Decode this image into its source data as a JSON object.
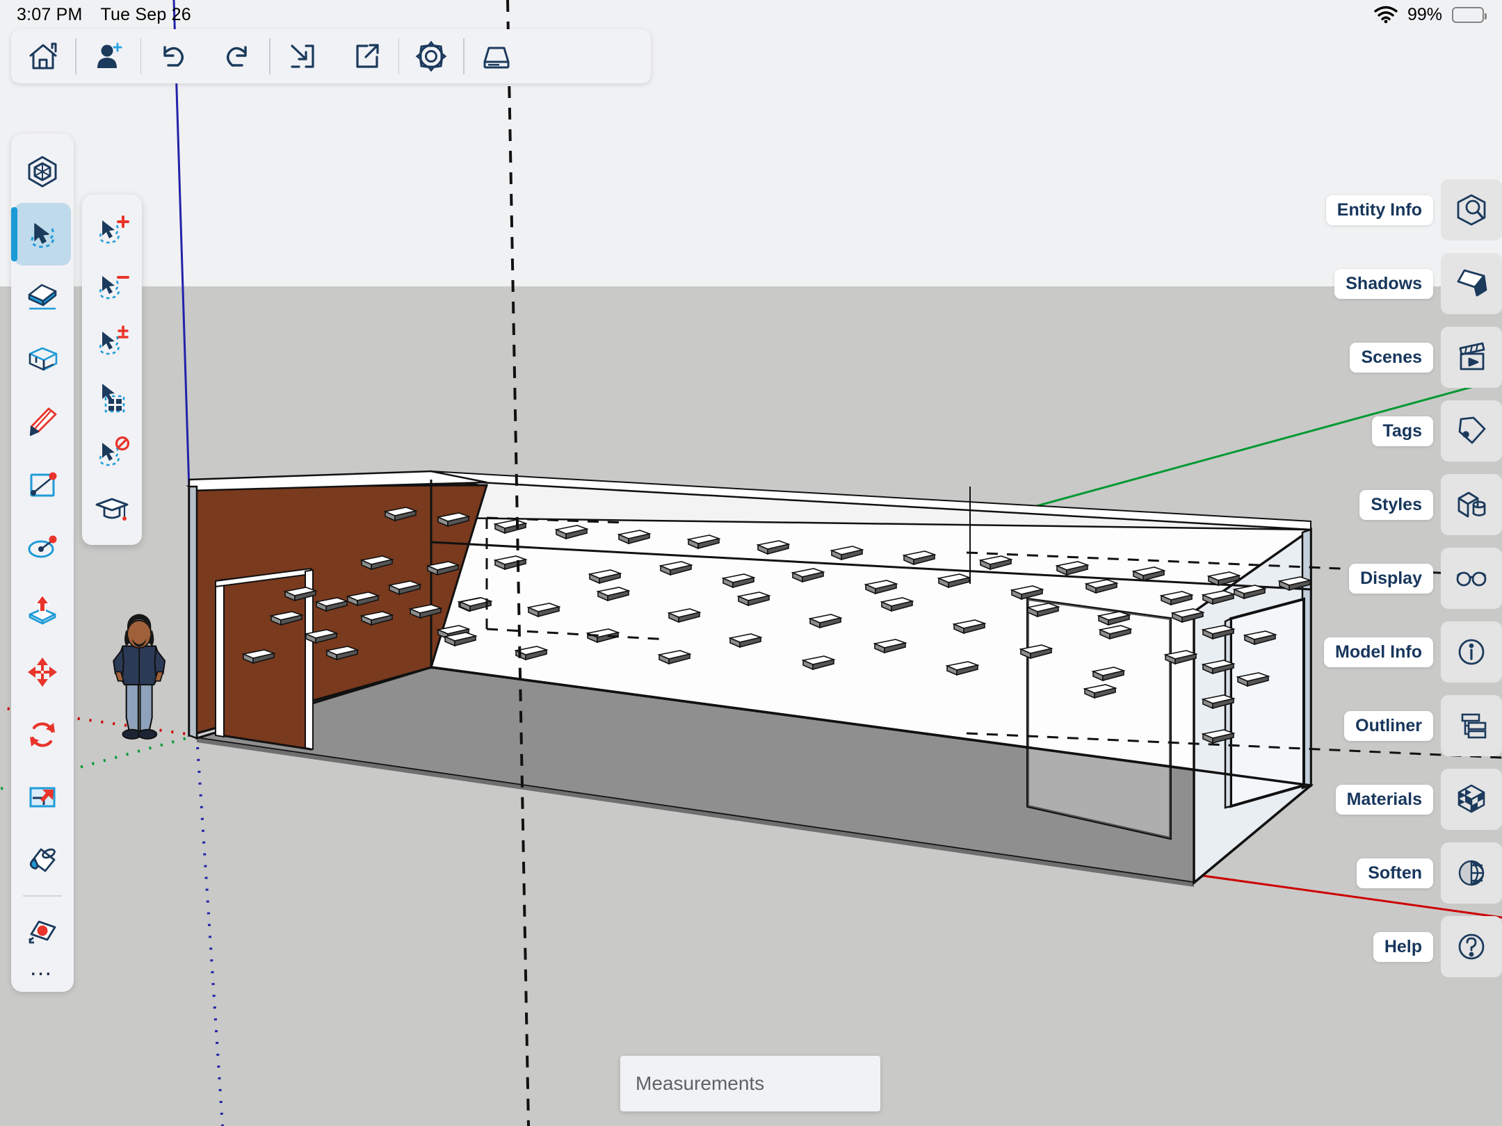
{
  "status_bar": {
    "time": "3:07 PM",
    "date": "Tue Sep 26",
    "battery_percent": "99%",
    "wifi_icon": "wifi-icon",
    "battery_icon": "battery-full-icon"
  },
  "top_toolbar": {
    "buttons": [
      {
        "name": "home-button",
        "icon": "home-icon",
        "label": "Home"
      },
      {
        "name": "add-user-button",
        "icon": "person-plus-icon",
        "label": "Invite"
      },
      {
        "name": "undo-button",
        "icon": "undo-icon",
        "label": "Undo"
      },
      {
        "name": "redo-button",
        "icon": "redo-icon",
        "label": "Redo"
      },
      {
        "name": "import-button",
        "icon": "import-icon",
        "label": "Import"
      },
      {
        "name": "export-button",
        "icon": "export-icon",
        "label": "Export"
      },
      {
        "name": "settings-button",
        "icon": "gear-icon",
        "label": "Settings"
      },
      {
        "name": "save-button",
        "icon": "disk-icon",
        "label": "Save"
      }
    ]
  },
  "left_toolbar": {
    "tools": [
      {
        "name": "tool-model",
        "icon": "cube-outline-icon",
        "label": "Model",
        "active": false
      },
      {
        "name": "tool-select",
        "icon": "select-lasso-icon",
        "label": "Select",
        "active": true
      },
      {
        "name": "tool-eraser",
        "icon": "eraser-icon",
        "label": "Eraser",
        "active": false
      },
      {
        "name": "tool-rectangle",
        "icon": "box-icon",
        "label": "Rectangle",
        "active": false
      },
      {
        "name": "tool-pencil",
        "icon": "pencil-icon",
        "label": "Line",
        "active": false
      },
      {
        "name": "tool-shape",
        "icon": "square-diagonal-icon",
        "label": "Shapes",
        "active": false
      },
      {
        "name": "tool-arc",
        "icon": "arc-icon",
        "label": "Arc",
        "active": false
      },
      {
        "name": "tool-pushpull",
        "icon": "push-pull-icon",
        "label": "Push/Pull",
        "active": false
      },
      {
        "name": "tool-move",
        "icon": "move-icon",
        "label": "Move",
        "active": false
      },
      {
        "name": "tool-rotate",
        "icon": "rotate-icon",
        "label": "Rotate",
        "active": false
      },
      {
        "name": "tool-scale",
        "icon": "scale-icon",
        "label": "Scale",
        "active": false
      },
      {
        "name": "tool-paint",
        "icon": "paint-bucket-icon",
        "label": "Paint",
        "active": false
      },
      {
        "name": "tool-tape",
        "icon": "tape-measure-icon",
        "label": "Tape Measure",
        "active": false
      }
    ],
    "more_label": "…"
  },
  "select_flyout": {
    "items": [
      {
        "name": "select-add-option",
        "icon": "cursor-plus-icon",
        "label": "Add to Selection"
      },
      {
        "name": "select-subtract-option",
        "icon": "cursor-minus-icon",
        "label": "Subtract from Selection"
      },
      {
        "name": "select-toggle-option",
        "icon": "cursor-toggle-icon",
        "label": "Toggle Selection"
      },
      {
        "name": "select-multiple-option",
        "icon": "cursor-marquee-icon",
        "label": "Select Multiple"
      },
      {
        "name": "select-none-option",
        "icon": "cursor-none-icon",
        "label": "Deselect All"
      },
      {
        "name": "learn-option",
        "icon": "graduation-cap-icon",
        "label": "Learn"
      }
    ]
  },
  "right_panel": {
    "items": [
      {
        "name": "panel-entity-info",
        "label": "Entity Info",
        "icon": "cube-search-icon"
      },
      {
        "name": "panel-shadows",
        "label": "Shadows",
        "icon": "shadow-icon"
      },
      {
        "name": "panel-scenes",
        "label": "Scenes",
        "icon": "clapperboard-icon"
      },
      {
        "name": "panel-tags",
        "label": "Tags",
        "icon": "tag-icon"
      },
      {
        "name": "panel-styles",
        "label": "Styles",
        "icon": "styles-shapes-icon"
      },
      {
        "name": "panel-display",
        "label": "Display",
        "icon": "glasses-icon"
      },
      {
        "name": "panel-model-info",
        "label": "Model Info",
        "icon": "info-circle-icon"
      },
      {
        "name": "panel-outliner",
        "label": "Outliner",
        "icon": "outliner-layers-icon"
      },
      {
        "name": "panel-materials",
        "label": "Materials",
        "icon": "checkered-cube-icon"
      },
      {
        "name": "panel-soften",
        "label": "Soften",
        "icon": "soften-sphere-icon"
      },
      {
        "name": "panel-help",
        "label": "Help",
        "icon": "question-circle-icon"
      }
    ]
  },
  "measurements": {
    "placeholder": "Measurements",
    "value": ""
  },
  "viewport": {
    "sky_color": "#f0f1f2",
    "ground_color": "#c9c9c7",
    "axis_red": "#cc0000",
    "axis_green": "#009933",
    "axis_blue": "#2222aa",
    "model_name": "warehouse-interior",
    "faces": {
      "end_wall_color": "#7a3a1e",
      "side_wall_light": "#fdfdfd",
      "side_wall_shaded": "#cfcfcf",
      "floor_color": "#8f8f8f",
      "outline_color": "#111111"
    },
    "scale_figure": {
      "name": "scale-figure-person",
      "shirt_color": "#2b3a55",
      "pants_color": "#8fa2bb",
      "shoe_color": "#1d2535",
      "skin_color": "#a0613a"
    },
    "inference_guides": "dashed-black"
  }
}
